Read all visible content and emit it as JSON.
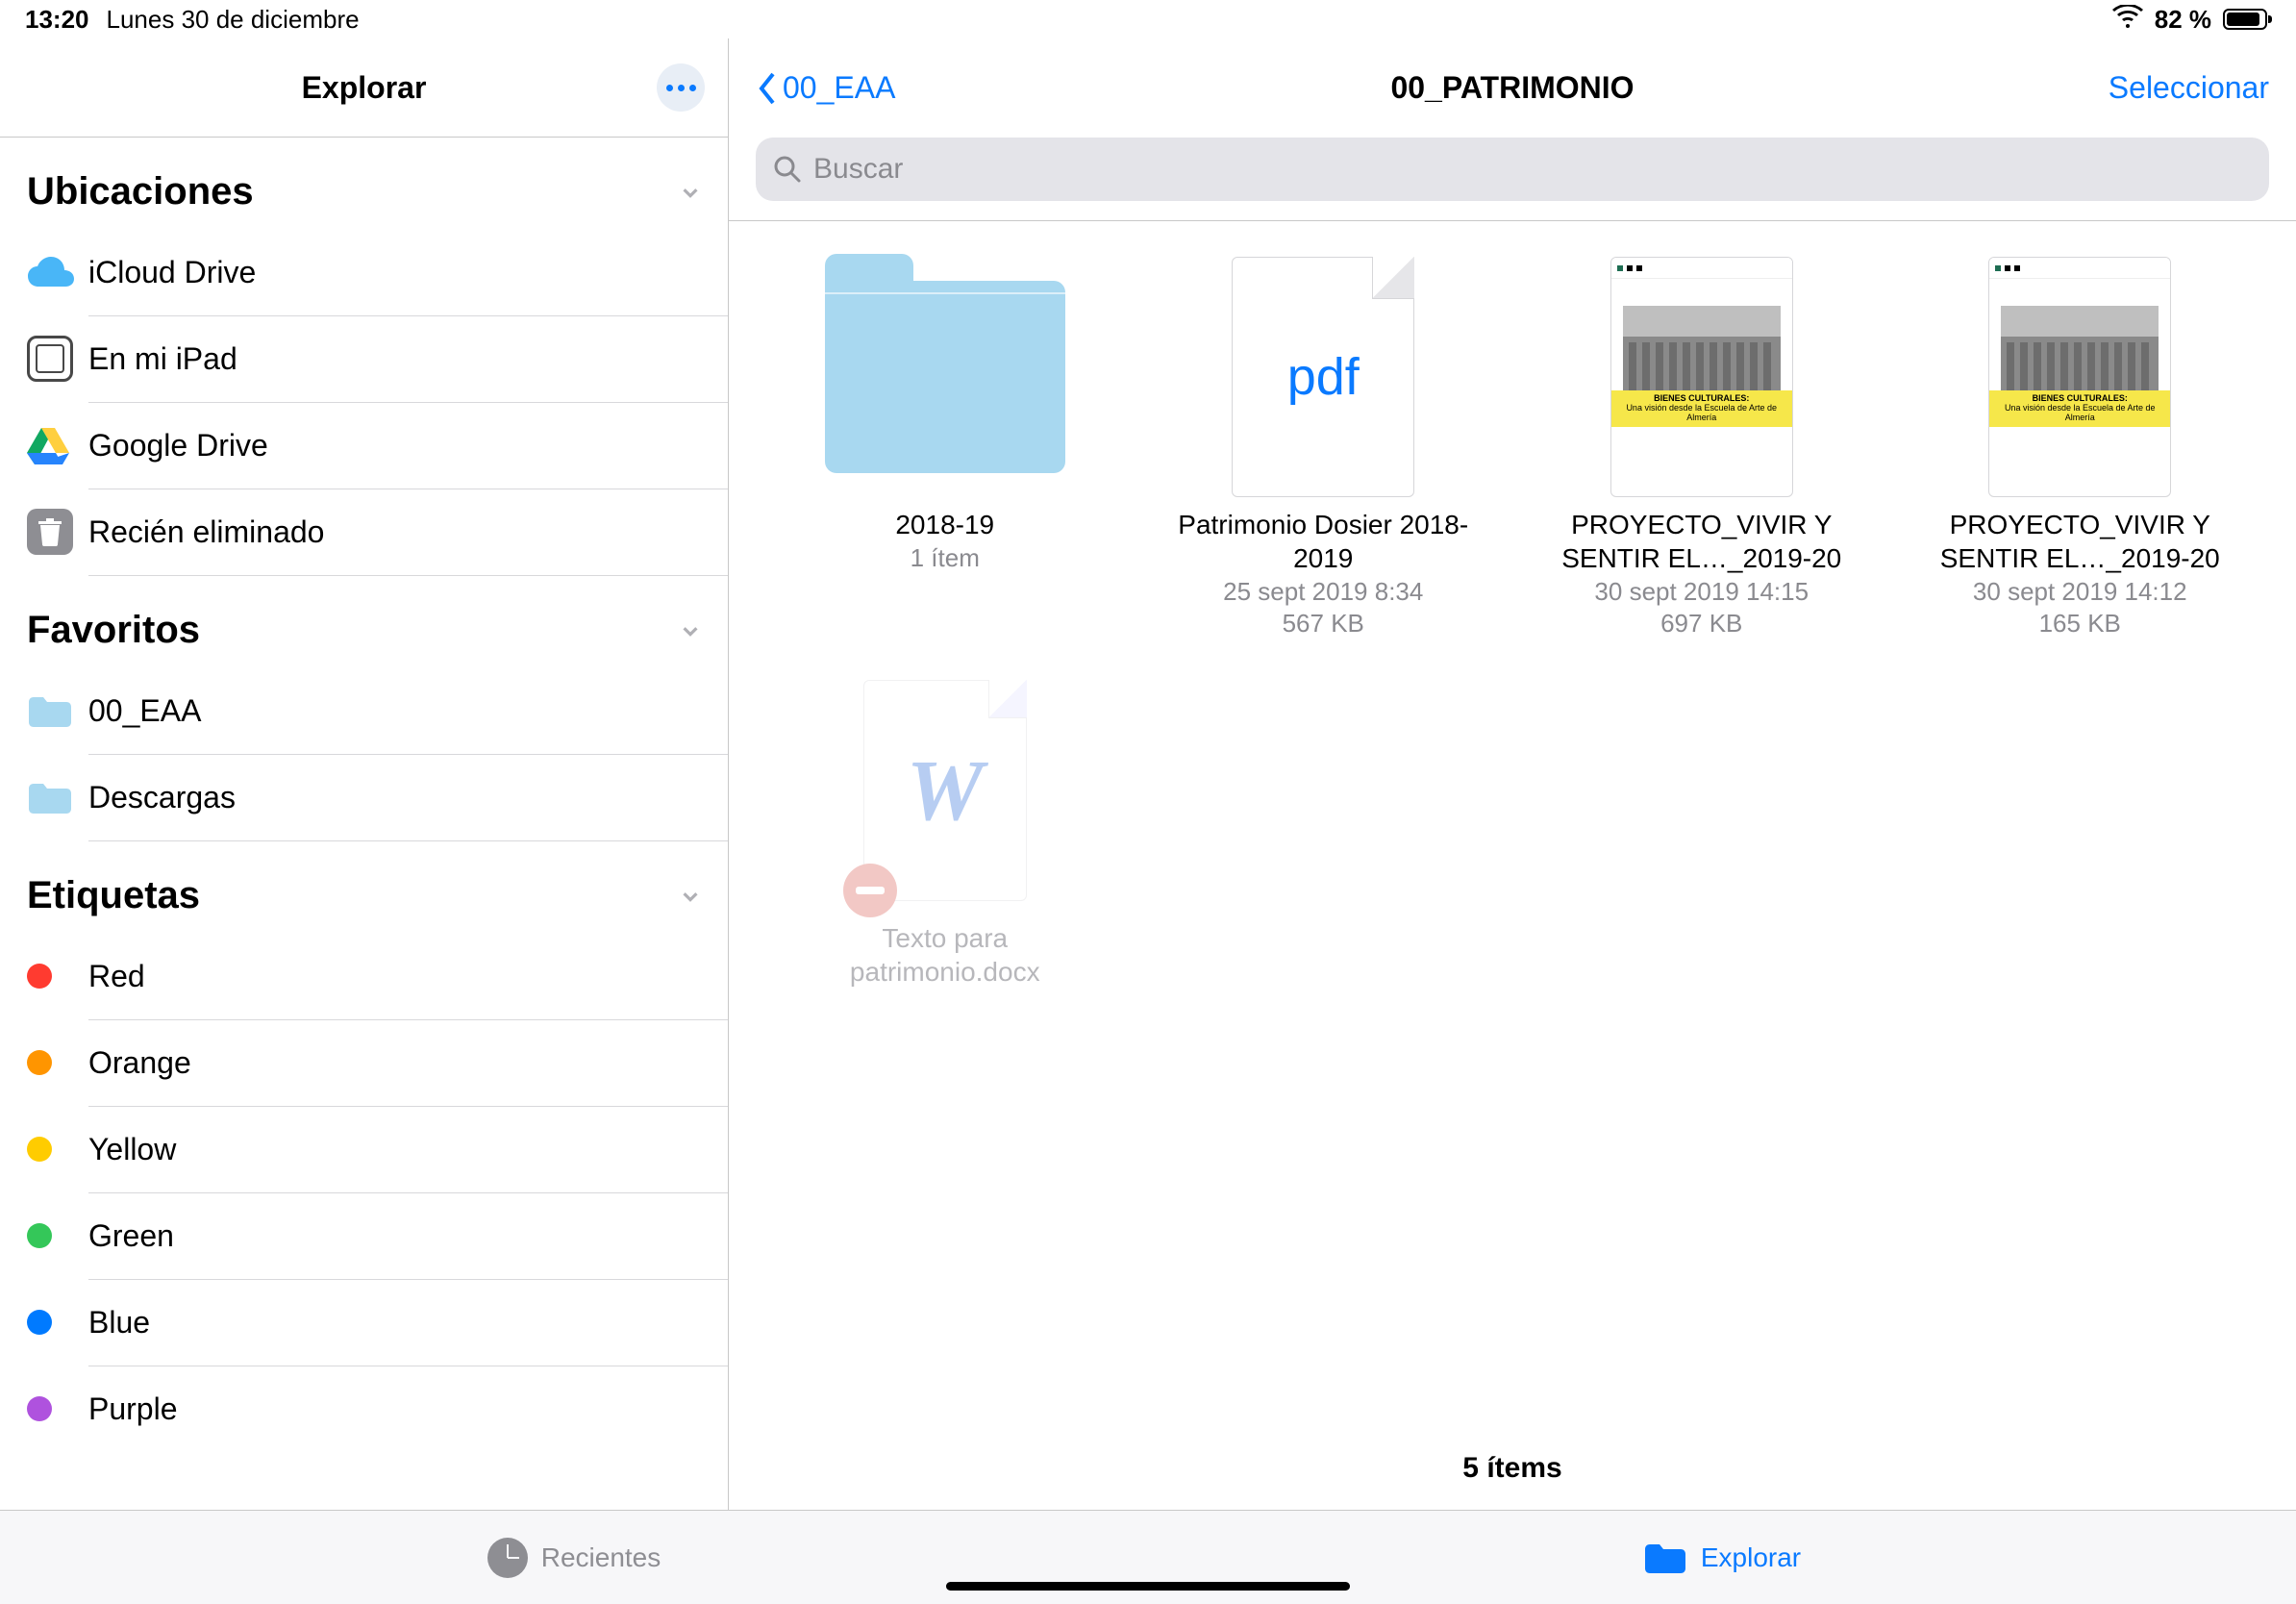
{
  "status": {
    "time": "13:20",
    "date": "Lunes 30 de diciembre",
    "battery_pct": "82 %"
  },
  "sidebar": {
    "title": "Explorar",
    "sections": {
      "locations": {
        "header": "Ubicaciones",
        "items": [
          {
            "label": "iCloud Drive"
          },
          {
            "label": "En mi iPad"
          },
          {
            "label": "Google Drive"
          },
          {
            "label": "Recién eliminado"
          }
        ]
      },
      "favorites": {
        "header": "Favoritos",
        "items": [
          {
            "label": "00_EAA"
          },
          {
            "label": "Descargas"
          }
        ]
      },
      "tags": {
        "header": "Etiquetas",
        "items": [
          {
            "label": "Red",
            "color": "#ff3b30"
          },
          {
            "label": "Orange",
            "color": "#ff9500"
          },
          {
            "label": "Yellow",
            "color": "#ffcc00"
          },
          {
            "label": "Green",
            "color": "#34c759"
          },
          {
            "label": "Blue",
            "color": "#007aff"
          },
          {
            "label": "Purple",
            "color": "#af52de"
          }
        ]
      }
    }
  },
  "main": {
    "back_label": "00_EAA",
    "title": "00_PATRIMONIO",
    "select_label": "Seleccionar",
    "search_placeholder": "Buscar",
    "count_label": "5 ítems",
    "items": [
      {
        "kind": "folder",
        "name": "2018-19",
        "sub1": "1 ítem",
        "sub2": ""
      },
      {
        "kind": "pdf",
        "name": "Patrimonio Dosier 2018-2019",
        "sub1": "25 sept 2019 8:34",
        "sub2": "567 KB"
      },
      {
        "kind": "doc-thumb",
        "name": "PROYECTO_VIVIR Y SENTIR EL…_2019-20",
        "sub1": "30 sept 2019 14:15",
        "sub2": "697 KB",
        "band_l1": "BIENES CULTURALES:",
        "band_l2": "Una visión desde la Escuela de Arte de Almería"
      },
      {
        "kind": "doc-thumb",
        "name": "PROYECTO_VIVIR Y SENTIR EL…_2019-20",
        "sub1": "30 sept 2019 14:12",
        "sub2": "165 KB",
        "band_l1": "BIENES CULTURALES:",
        "band_l2": "Una visión desde la Escuela de Arte de Almería"
      },
      {
        "kind": "word-ghost",
        "name": "Texto para patrimonio.docx",
        "sub1": "",
        "sub2": ""
      }
    ]
  },
  "tabs": {
    "recents": "Recientes",
    "browse": "Explorar"
  },
  "colors": {
    "accent": "#0a7aff",
    "folder": "#a8d8f0"
  }
}
